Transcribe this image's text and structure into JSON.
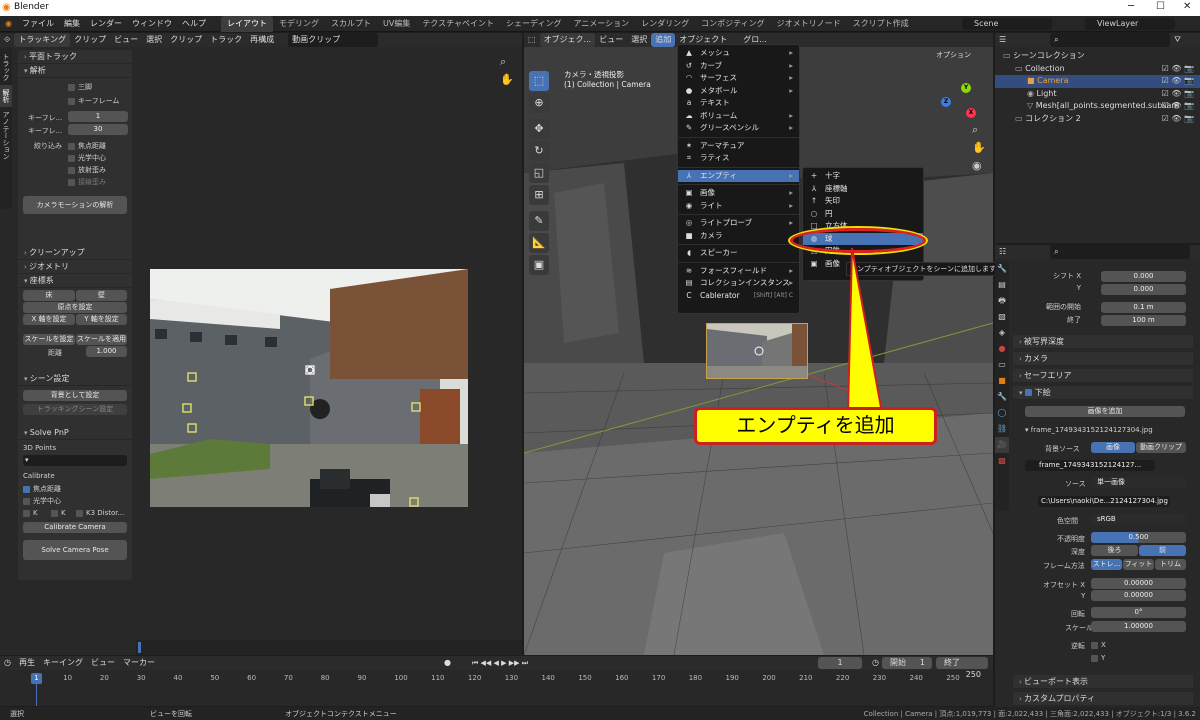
{
  "title": "Blender",
  "menu": [
    "ファイル",
    "編集",
    "レンダー",
    "ウィンドウ",
    "ヘルプ"
  ],
  "workspaces": [
    "レイアウト",
    "モデリング",
    "スカルプト",
    "UV編集",
    "テクスチャペイント",
    "シェーディング",
    "アニメーション",
    "レンダリング",
    "コンポジティング",
    "ジオメトリノード",
    "スクリプト作成"
  ],
  "scene": "Scene",
  "view_layer": "ViewLayer",
  "clip": {
    "header": {
      "mode": "トラッキング",
      "clip_label": "クリップ",
      "menus": [
        "ビュー",
        "選択",
        "クリップ",
        "トラック",
        "再構成"
      ],
      "clip_name": "動画クリップ"
    },
    "side_tabs": [
      "トラック",
      "解析",
      "アノテーション"
    ],
    "sections": {
      "plane": "平面トラック",
      "solve": "解析",
      "cleanup": "クリーンアップ",
      "geometry": "ジオメトリ",
      "orient": "座標系",
      "scene": "シーン設定",
      "pnp": "Solve PnP"
    },
    "solve": {
      "tripod": "三脚",
      "keyframe": "キーフレーム",
      "kf_a_label": "キーフレ...",
      "kf_a": "1",
      "kf_b_label": "キーフレ...",
      "kf_b": "30",
      "refine": "絞り込み",
      "focal": "焦点距離",
      "optical": "光学中心",
      "radial": "放射歪み",
      "tangent": "接線歪み",
      "motion_btn": "カメラモーションの解析"
    },
    "orient": {
      "floor": "床",
      "wall": "壁",
      "origin": "原点を設定",
      "x_axis": "X 軸を設定",
      "y_axis": "Y 軸を設定",
      "scale_set": "スケールを設定",
      "scale_apply": "スケールを適用",
      "distance_label": "距離",
      "distance": "1.000"
    },
    "scene_setup": {
      "bg": "背景として設定",
      "track_scene": "トラッキングシーン設定"
    },
    "pnp": {
      "points": "3D Points",
      "calibrate": "Calibrate",
      "focal": "焦点距離",
      "optical": "光学中心",
      "k_label": "K",
      "k2_label": "K",
      "k3": "K3 Distor...",
      "calib_btn": "Calibrate Camera",
      "solve_btn": "Solve Camera Pose"
    }
  },
  "viewport": {
    "header": {
      "mode": "オブジェク...",
      "menus": [
        "ビュー",
        "選択",
        "追加",
        "オブジェクト"
      ],
      "global": "グロ...",
      "options": "オプション"
    },
    "cam_title": "カメラ・透視投影",
    "cam_sub": "(1) Collection | Camera"
  },
  "add_menu": {
    "items": [
      {
        "label": "メッシュ",
        "icon": "▲",
        "sub": true
      },
      {
        "label": "カーブ",
        "icon": "↺",
        "sub": true
      },
      {
        "label": "サーフェス",
        "icon": "◠",
        "sub": true
      },
      {
        "label": "メタボール",
        "icon": "●",
        "sub": true
      },
      {
        "label": "テキスト",
        "icon": "a",
        "sub": false
      },
      {
        "label": "ボリューム",
        "icon": "☁",
        "sub": true
      },
      {
        "label": "グリースペンシル",
        "icon": "✎",
        "sub": true
      },
      {
        "label": "アーマチュア",
        "icon": "✶",
        "sub": false
      },
      {
        "label": "ラティス",
        "icon": "⌗",
        "sub": false
      },
      {
        "label": "エンプティ",
        "icon": "⅄",
        "sub": true,
        "hl": true
      },
      {
        "label": "画像",
        "icon": "▣",
        "sub": true
      },
      {
        "label": "ライト",
        "icon": "◉",
        "sub": true
      },
      {
        "label": "ライトプローブ",
        "icon": "◎",
        "sub": true
      },
      {
        "label": "カメラ",
        "icon": "■",
        "sub": false
      },
      {
        "label": "スピーカー",
        "icon": "◖",
        "sub": false
      },
      {
        "label": "フォースフィールド",
        "icon": "≋",
        "sub": true
      },
      {
        "label": "コレクションインスタンス",
        "icon": "▤",
        "sub": true
      },
      {
        "label": "Cablerator",
        "icon": "C",
        "sub": false,
        "shortcut": "[Shift] [Alt] C"
      }
    ]
  },
  "empty_menu": {
    "items": [
      {
        "label": "十字",
        "icon": "+"
      },
      {
        "label": "座標軸",
        "icon": "⅄"
      },
      {
        "label": "矢印",
        "icon": "↑"
      },
      {
        "label": "円",
        "icon": "○"
      },
      {
        "label": "立方体",
        "icon": "□"
      },
      {
        "label": "球",
        "icon": "◍",
        "hl": true
      },
      {
        "label": "円錐",
        "icon": "△"
      },
      {
        "label": "画像",
        "icon": "▣"
      }
    ]
  },
  "tooltip": "エンプティオブジェクトをシーンに追加します: 球",
  "callout": "エンプティを追加",
  "outliner": {
    "items": [
      {
        "label": "シーンコレクション",
        "depth": 0
      },
      {
        "label": "Collection",
        "depth": 1
      },
      {
        "label": "Camera",
        "depth": 2,
        "sel": true
      },
      {
        "label": "Light",
        "depth": 2
      },
      {
        "label": "Mesh[all_points.segmented.subsam",
        "depth": 2
      },
      {
        "label": "コレクション 2",
        "depth": 1
      }
    ]
  },
  "props": {
    "shift_x_label": "シフト X",
    "shift_x": "0.000",
    "y_label": "Y",
    "shift_y": "0.000",
    "clip_start_label": "範囲の開始",
    "clip_start": "0.1 m",
    "clip_end_label": "終了",
    "clip_end": "100 m",
    "dof": "被写界深度",
    "camera": "カメラ",
    "safe": "セーフエリア",
    "bg": "下絵",
    "add_image": "画像を追加",
    "frame_file": "frame_1749343152124127304.jpg",
    "bg_source_label": "背景ソース",
    "src_image": "画像",
    "src_clip": "動画クリップ",
    "frame_file2": "frame_1749343152124127...",
    "source_label": "ソース",
    "source": "単一画像",
    "filepath": "C:\\Users\\naoki\\De...2124127304.jpg",
    "colorspace_label": "色空間",
    "colorspace": "sRGB",
    "opacity_label": "不透明度",
    "opacity": "0.500",
    "depth_label": "深度",
    "depth_back": "後ろ",
    "depth_front": "前",
    "frame_method_label": "フレーム方法",
    "fm_stretch": "ストレ...",
    "fm_fit": "フィット",
    "fm_crop": "トリム",
    "offset_x_label": "オフセット X",
    "offset_x": "0.00000",
    "offset_y_label": "Y",
    "offset_y": "0.00000",
    "rot_label": "回転",
    "rot": "0°",
    "scale_label": "スケール",
    "scale": "1.00000",
    "flip_label": "逆転",
    "flip_x": "X",
    "flip_y": "Y",
    "viewport_display": "ビューポート表示",
    "custom_props": "カスタムプロパティ"
  },
  "timeline": {
    "menus": [
      "再生",
      "キーイング",
      "ビュー",
      "マーカー"
    ],
    "current": "1",
    "start_label": "開始",
    "start": "1",
    "end_label": "終了",
    "end": "250",
    "ticks": [
      "1",
      "10",
      "20",
      "30",
      "40",
      "50",
      "60",
      "70",
      "80",
      "90",
      "100",
      "110",
      "120",
      "130",
      "140",
      "150",
      "160",
      "170",
      "180",
      "190",
      "200",
      "210",
      "220",
      "230",
      "240",
      "250"
    ]
  },
  "status": {
    "left": "選択",
    "mid": "ビューを回転",
    "right": "オブジェクトコンテクストメニュー",
    "info": "Collection | Camera | 頂点:1,019,773 | 面:2,022,433 | 三角面:2,022,433 | オブジェクト:1/3 | 3.6.2"
  },
  "colors": {
    "accent": "#4772b3",
    "callout_yellow": "#ffff00",
    "callout_red": "#cc2020"
  }
}
